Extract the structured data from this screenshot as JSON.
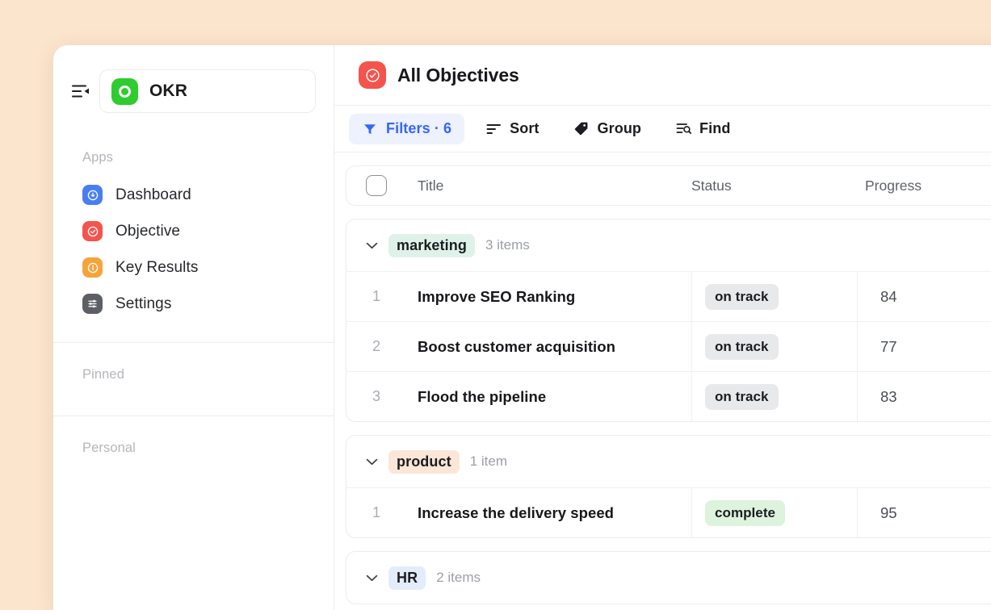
{
  "background_color": "#fce5cd",
  "sidebar": {
    "collapse_icon": "sidebar-collapse-icon",
    "workspace": {
      "name": "OKR",
      "logo_icon": "okr-circle-logo",
      "logo_color": "#2ecc2e"
    },
    "apps_label": "Apps",
    "items": [
      {
        "label": "Dashboard",
        "icon": "dashboard-icon",
        "color": "#4a7ef0"
      },
      {
        "label": "Objective",
        "icon": "objective-icon",
        "color": "#f4544d"
      },
      {
        "label": "Key Results",
        "icon": "key-results-icon",
        "color": "#f6a33c"
      },
      {
        "label": "Settings",
        "icon": "settings-sliders-icon",
        "color": "#5c6066"
      }
    ],
    "pinned_label": "Pinned",
    "personal_label": "Personal"
  },
  "header": {
    "title": "All Objectives",
    "icon": "objective-check-icon",
    "icon_color": "#f4544d"
  },
  "toolbar": {
    "filters_label": "Filters · 6",
    "filters_icon": "funnel-icon",
    "filters_active_color": "#3366ff",
    "sort_label": "Sort",
    "sort_icon": "sort-lines-icon",
    "group_label": "Group",
    "group_icon": "tag-icon",
    "find_label": "Find",
    "find_icon": "find-search-icon"
  },
  "table": {
    "columns": {
      "select_all": "select-all-checkbox",
      "title": "Title",
      "status": "Status",
      "progress": "Progress"
    },
    "groups": [
      {
        "name": "marketing",
        "badge_bg": "#dff2e9",
        "count_label": "3 items",
        "rows": [
          {
            "num": "1",
            "title": "Improve SEO Ranking",
            "status": "on track",
            "status_bg": "#e8e9eb",
            "progress": "84"
          },
          {
            "num": "2",
            "title": "Boost customer acquisition",
            "status": "on track",
            "status_bg": "#e8e9eb",
            "progress": "77"
          },
          {
            "num": "3",
            "title": "Flood the pipeline",
            "status": "on track",
            "status_bg": "#e8e9eb",
            "progress": "83"
          }
        ]
      },
      {
        "name": "product",
        "badge_bg": "#fbe6d8",
        "count_label": "1 item",
        "rows": [
          {
            "num": "1",
            "title": "Increase the delivery speed",
            "status": "complete",
            "status_bg": "#ddf3dd",
            "progress": "95"
          }
        ]
      },
      {
        "name": "HR",
        "badge_bg": "#e3ecfb",
        "count_label": "2 items",
        "rows": []
      }
    ]
  }
}
